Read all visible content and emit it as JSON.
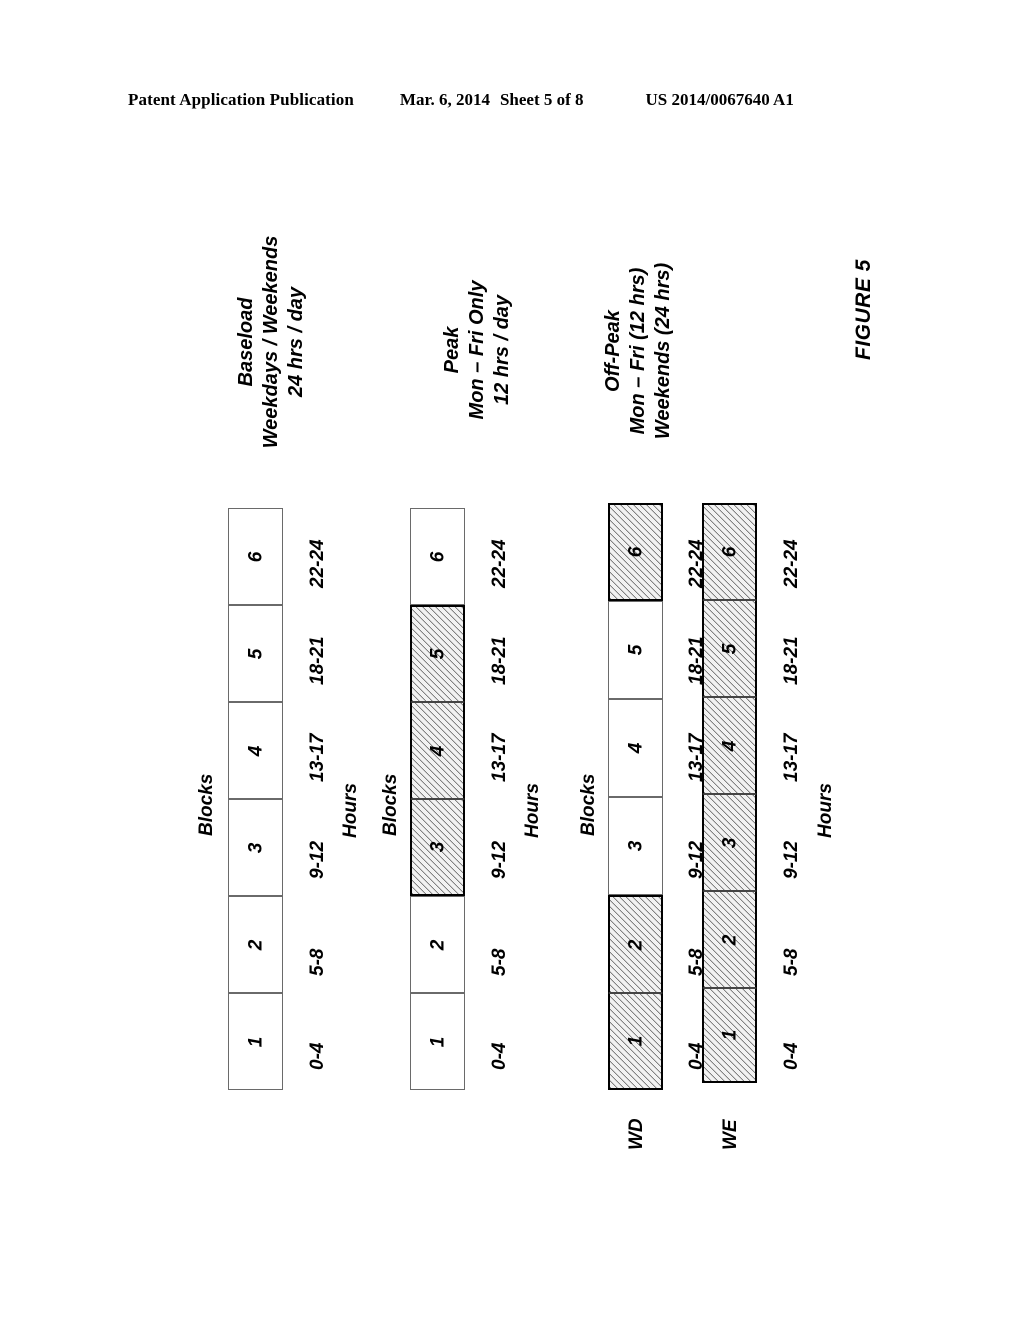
{
  "header": {
    "publication": "Patent Application Publication",
    "date": "Mar. 6, 2014",
    "sheet": "Sheet 5 of 8",
    "patent_number": "US 2014/0067640 A1"
  },
  "figure": {
    "label": "FIGURE 5",
    "blocks_axis_label": "Blocks",
    "hours_axis_label": "Hours",
    "block_numbers": [
      "1",
      "2",
      "3",
      "4",
      "5",
      "6"
    ],
    "hour_ranges": [
      "0-4",
      "5-8",
      "9-12",
      "13-17",
      "18-21",
      "22-24"
    ],
    "groups": [
      {
        "id": "baseload",
        "caption_lines": [
          "Baseload",
          "Weekdays / Weekends",
          "24 hrs / day"
        ],
        "row_label": "",
        "filled": [
          false,
          false,
          false,
          false,
          false,
          false
        ]
      },
      {
        "id": "peak",
        "caption_lines": [
          "Peak",
          "Mon – Fri Only",
          "12 hrs / day"
        ],
        "row_label": "",
        "filled": [
          false,
          false,
          true,
          true,
          true,
          false
        ]
      },
      {
        "id": "offpeak-wd",
        "caption_lines": [
          "Off-Peak",
          "Mon – Fri (12 hrs)",
          "Weekends (24 hrs)"
        ],
        "row_label": "WD",
        "filled": [
          true,
          true,
          false,
          false,
          false,
          true
        ]
      },
      {
        "id": "offpeak-we",
        "caption_lines": [],
        "row_label": "WE",
        "filled": [
          true,
          true,
          true,
          true,
          true,
          true
        ]
      }
    ]
  },
  "colors": {
    "ink": "#000000",
    "paper": "#ffffff",
    "hatch_fill": "#f2f2f2",
    "block_border": "#555555"
  }
}
